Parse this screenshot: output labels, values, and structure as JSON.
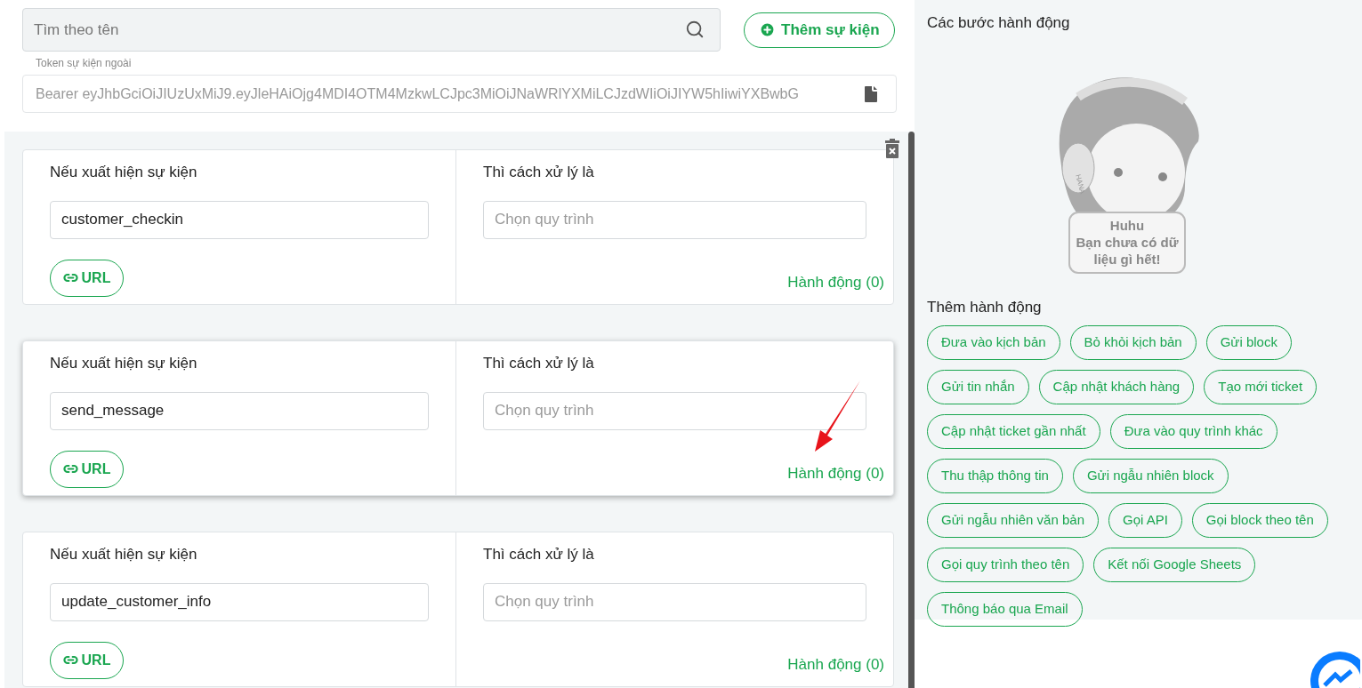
{
  "search": {
    "placeholder": "Tìm theo tên"
  },
  "add_event_button": "Thêm sự kiện",
  "token": {
    "label": "Token sự kiện ngoài",
    "value": "Bearer eyJhbGciOiJIUzUxMiJ9.eyJleHAiOjg4MDI4OTM4MzkwLCJpc3MiOiJNaWRlYXMiLCJzdWIiOiJIYW5hIiwiYXBwbG"
  },
  "events": [
    {
      "event_label": "Nếu xuất hiện sự kiện",
      "event_value": "customer_checkin",
      "url_button": "URL",
      "handler_label": "Thì cách xử lý là",
      "handler_placeholder": "Chọn quy trình",
      "actions_link": "Hành động (0)",
      "selected": false
    },
    {
      "event_label": "Nếu xuất hiện sự kiện",
      "event_value": "send_message",
      "url_button": "URL",
      "handler_label": "Thì cách xử lý là",
      "handler_placeholder": "Chọn quy trình",
      "actions_link": "Hành động (0)",
      "selected": true
    },
    {
      "event_label": "Nếu xuất hiện sự kiện",
      "event_value": "update_customer_info",
      "url_button": "URL",
      "handler_label": "Thì cách xử lý là",
      "handler_placeholder": "Chọn quy trình",
      "actions_link": "Hành động (0)",
      "selected": false
    }
  ],
  "side_panel": {
    "title": "Các bước hành động",
    "empty_state": {
      "badge": "HANA",
      "sign_lines": [
        "Huhu",
        "Bạn chưa có dữ",
        "liệu gì hết!"
      ]
    },
    "add_title": "Thêm hành động",
    "actions": [
      "Đưa vào kịch bản",
      "Bỏ khỏi kịch bản",
      "Gửi block",
      "Gửi tin nhắn",
      "Cập nhật khách hàng",
      "Tạo mới ticket",
      "Cập nhật ticket gần nhất",
      "Đưa vào quy trình khác",
      "Thu thập thông tin",
      "Gửi ngẫu nhiên block",
      "Gửi ngẫu nhiên văn bản",
      "Gọi API",
      "Gọi block theo tên",
      "Gọi quy trình theo tên",
      "Kết nối Google Sheets",
      "Thông báo qua Email"
    ]
  }
}
